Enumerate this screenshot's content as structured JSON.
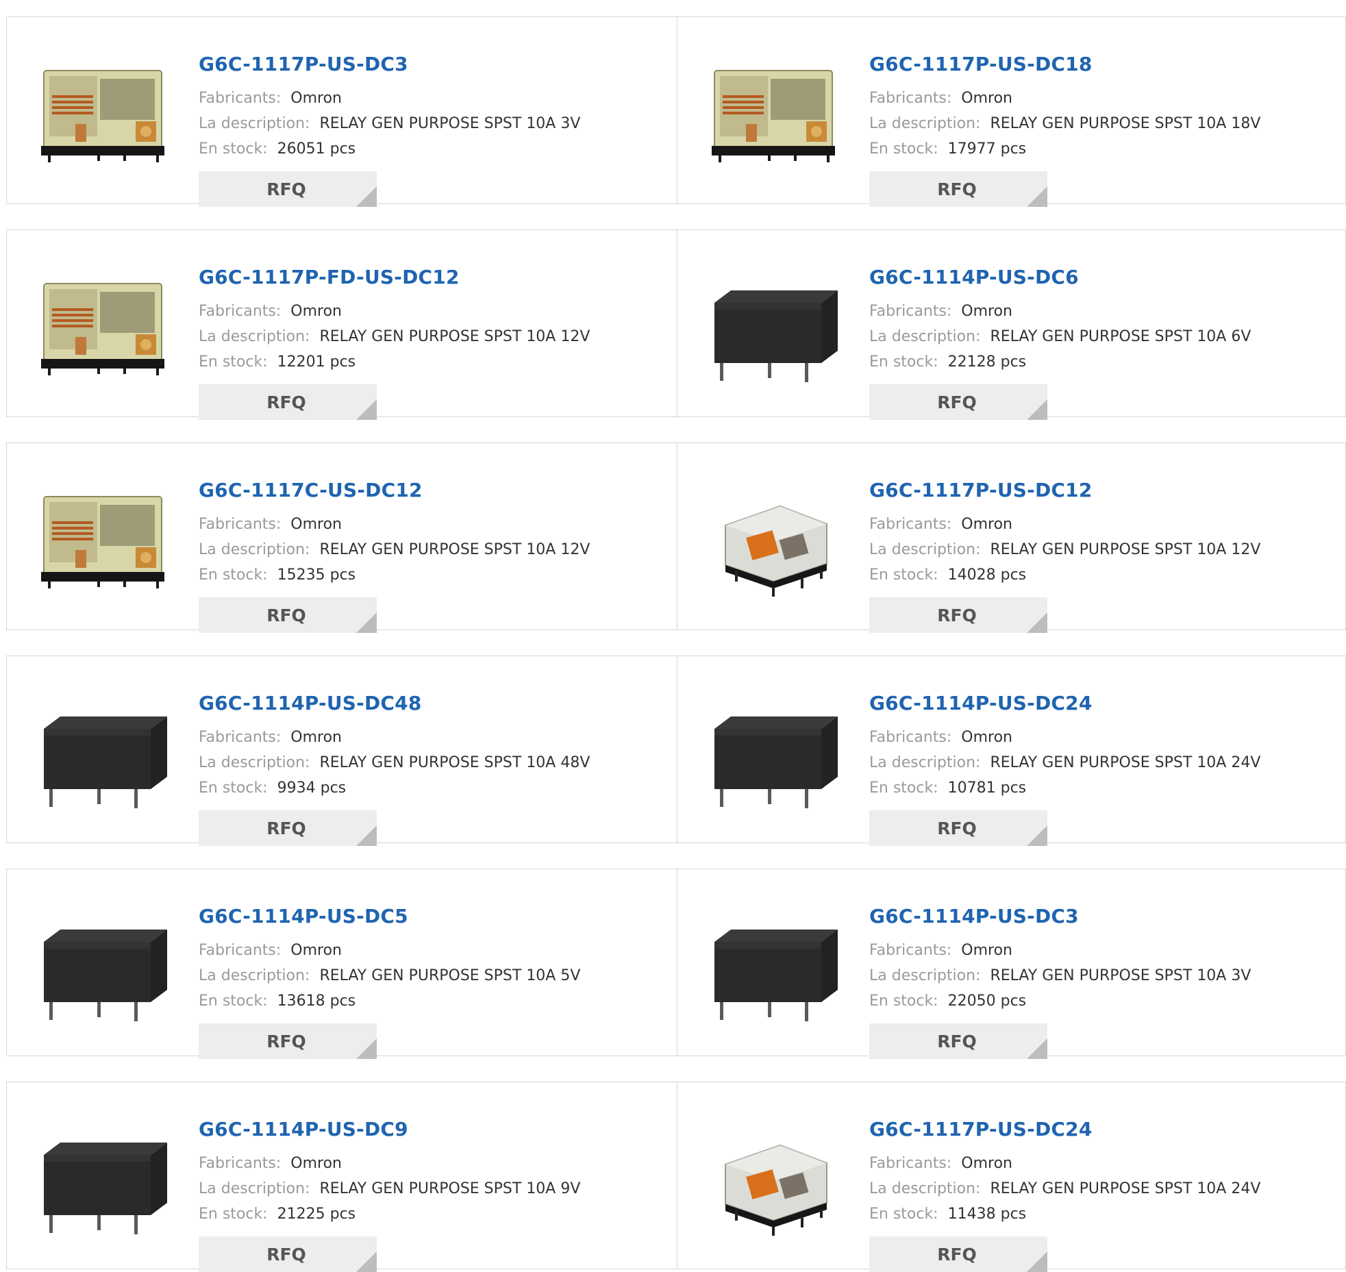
{
  "labels": {
    "manufacturer": "Fabricants:",
    "description": "La description:",
    "stock": "En stock:",
    "rfq": "RFQ"
  },
  "icons": {
    "clear": "relay-clear-icon",
    "clear_small": "relay-clear-small-icon",
    "black": "relay-black-icon"
  },
  "colors": {
    "part_link": "#1f64b0",
    "label": "#9a9a9a",
    "value": "#333333",
    "button_bg": "#ededed"
  },
  "products": [
    {
      "part": "G6C-1117P-US-DC3",
      "manufacturer": "Omron",
      "description": "RELAY GEN PURPOSE SPST 10A 3V",
      "stock": "26051 pcs",
      "image": "clear"
    },
    {
      "part": "G6C-1117P-US-DC18",
      "manufacturer": "Omron",
      "description": "RELAY GEN PURPOSE SPST 10A 18V",
      "stock": "17977 pcs",
      "image": "clear"
    },
    {
      "part": "G6C-1117P-FD-US-DC12",
      "manufacturer": "Omron",
      "description": "RELAY GEN PURPOSE SPST 10A 12V",
      "stock": "12201 pcs",
      "image": "clear"
    },
    {
      "part": "G6C-1114P-US-DC6",
      "manufacturer": "Omron",
      "description": "RELAY GEN PURPOSE SPST 10A 6V",
      "stock": "22128 pcs",
      "image": "black"
    },
    {
      "part": "G6C-1117C-US-DC12",
      "manufacturer": "Omron",
      "description": "RELAY GEN PURPOSE SPST 10A 12V",
      "stock": "15235 pcs",
      "image": "clear"
    },
    {
      "part": "G6C-1117P-US-DC12",
      "manufacturer": "Omron",
      "description": "RELAY GEN PURPOSE SPST 10A 12V",
      "stock": "14028 pcs",
      "image": "clear_small"
    },
    {
      "part": "G6C-1114P-US-DC48",
      "manufacturer": "Omron",
      "description": "RELAY GEN PURPOSE SPST 10A 48V",
      "stock": "9934 pcs",
      "image": "black"
    },
    {
      "part": "G6C-1114P-US-DC24",
      "manufacturer": "Omron",
      "description": "RELAY GEN PURPOSE SPST 10A 24V",
      "stock": "10781 pcs",
      "image": "black"
    },
    {
      "part": "G6C-1114P-US-DC5",
      "manufacturer": "Omron",
      "description": "RELAY GEN PURPOSE SPST 10A 5V",
      "stock": "13618 pcs",
      "image": "black"
    },
    {
      "part": "G6C-1114P-US-DC3",
      "manufacturer": "Omron",
      "description": "RELAY GEN PURPOSE SPST 10A 3V",
      "stock": "22050 pcs",
      "image": "black"
    },
    {
      "part": "G6C-1114P-US-DC9",
      "manufacturer": "Omron",
      "description": "RELAY GEN PURPOSE SPST 10A 9V",
      "stock": "21225 pcs",
      "image": "black"
    },
    {
      "part": "G6C-1117P-US-DC24",
      "manufacturer": "Omron",
      "description": "RELAY GEN PURPOSE SPST 10A 24V",
      "stock": "11438 pcs",
      "image": "clear_small"
    }
  ]
}
